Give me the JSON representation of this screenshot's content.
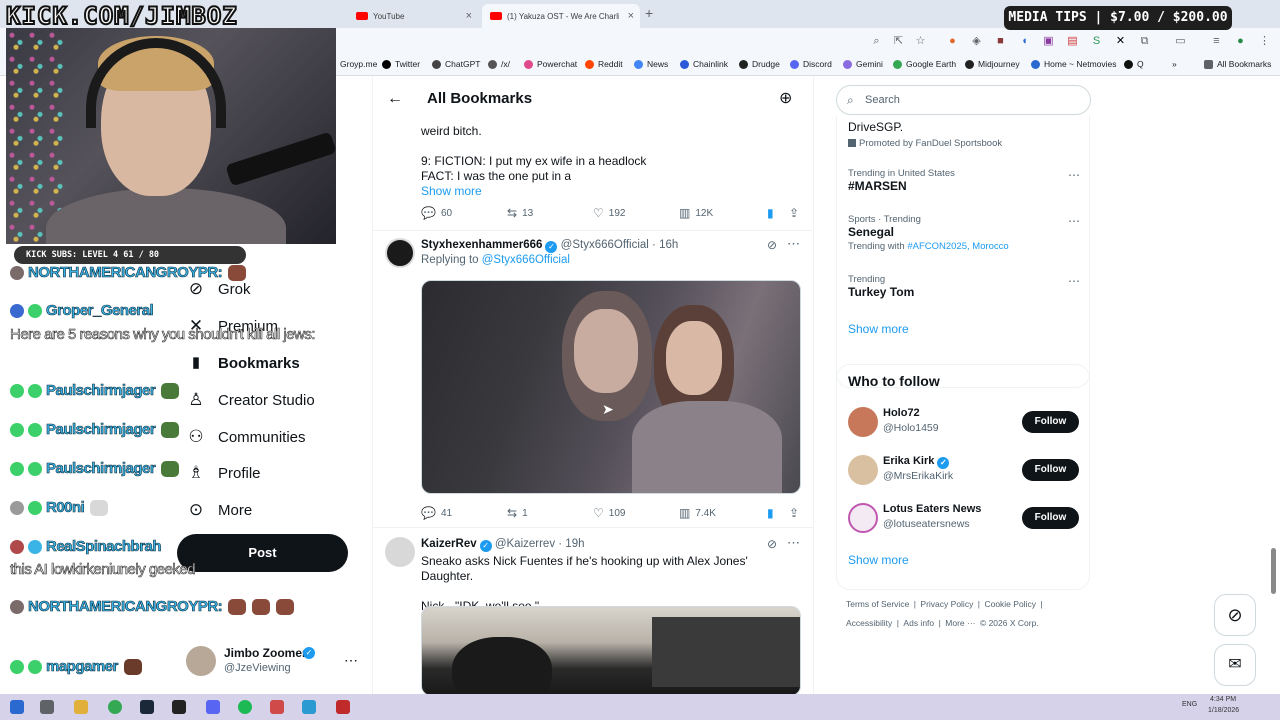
{
  "overlay": {
    "channel_url": "KICK.COM/JIMBOZ",
    "subs_bar": "KICK SUBS: LEVEL 4 61 / 80",
    "media_tips": "MEDIA TIPS | $7.00 / $200.00",
    "chat": [
      {
        "name": "NORTHAMERICANGROYPR:",
        "msg": "",
        "badge": "#7a6a6a"
      },
      {
        "name": "Groper_General",
        "msg": "",
        "badge": "#3a6ad0"
      },
      {
        "name": "",
        "msg": "Here are 5 reasons why you shouldn't kill all jews:",
        "badge": ""
      },
      {
        "name": "Paulschirmjager",
        "msg": "",
        "badge": "#3bd06a"
      },
      {
        "name": "Paulschirmjager",
        "msg": "",
        "badge": "#3bd06a"
      },
      {
        "name": "Paulschirmjager",
        "msg": "",
        "badge": "#3bd06a"
      },
      {
        "name": "R00ni",
        "msg": "",
        "badge": "#9a9a9a"
      },
      {
        "name": "RealSpinachbrah",
        "msg": "",
        "badge": "#b04a4a"
      },
      {
        "name": "",
        "msg": "this AI lowkirkeniunely geeked",
        "badge": ""
      },
      {
        "name": "NORTHAMERICANGROYPR:",
        "msg": "",
        "badge": "#7a6a6a"
      },
      {
        "name": "mapgamer",
        "msg": "",
        "badge": "#3bd06a"
      }
    ]
  },
  "browser": {
    "tabs": [
      {
        "label": "YouTube",
        "color": "#ff0000"
      },
      {
        "label": "(1) Yakuza OST - We Are Charlie",
        "color": "#ff0000"
      }
    ],
    "bookmarks": [
      {
        "label": "Groyp.me",
        "color": "#7a7a7a"
      },
      {
        "label": "Twitter",
        "color": "#000000"
      },
      {
        "label": "ChatGPT",
        "color": "#444444"
      },
      {
        "label": "/x/",
        "color": "#555555"
      },
      {
        "label": "Powerchat",
        "color": "#e04a8a"
      },
      {
        "label": "Reddit",
        "color": "#ff4500"
      },
      {
        "label": "News",
        "color": "#4285f4"
      },
      {
        "label": "Chainlink",
        "color": "#2a5ada"
      },
      {
        "label": "Drudge",
        "color": "#222222"
      },
      {
        "label": "Discord",
        "color": "#5865f2"
      },
      {
        "label": "Gemini",
        "color": "#8a6ae0"
      },
      {
        "label": "Google Earth",
        "color": "#34a853"
      },
      {
        "label": "Midjourney",
        "color": "#222222"
      },
      {
        "label": "Home ~ Netmovies",
        "color": "#2a6ad0"
      },
      {
        "label": "Q",
        "color": "#111111"
      },
      {
        "label": "All Bookmarks",
        "color": "#5f6368"
      }
    ]
  },
  "sidebar": {
    "items": [
      {
        "label": "Grok",
        "icon": "grok-icon",
        "glyph": "⊘",
        "bold": false
      },
      {
        "label": "Premium",
        "icon": "x-logo-icon",
        "glyph": "𝕏",
        "bold": false
      },
      {
        "label": "Bookmarks",
        "icon": "bookmark-icon",
        "glyph": "🔖",
        "bold": true
      },
      {
        "label": "Creator Studio",
        "icon": "creator-studio-icon",
        "glyph": "♙",
        "bold": false
      },
      {
        "label": "Communities",
        "icon": "communities-icon",
        "glyph": "👥",
        "bold": false
      },
      {
        "label": "Profile",
        "icon": "profile-icon",
        "glyph": "👤",
        "bold": false
      },
      {
        "label": "More",
        "icon": "more-icon",
        "glyph": "⋯",
        "bold": false
      }
    ],
    "post_label": "Post",
    "account": {
      "name": "Jimbo Zoomer",
      "handle": "@JzeViewing"
    }
  },
  "main": {
    "title": "All Bookmarks",
    "tweets": [
      {
        "text_lines": [
          "weird bitch.",
          "",
          "9: FICTION: I put my ex wife in a headlock",
          "FACT: I was the one put in a"
        ],
        "show_more": "Show more",
        "replies": "60",
        "reposts": "13",
        "likes": "192",
        "views": "12K"
      },
      {
        "name": "Styxhexenhammer666",
        "handle": "@Styx666Official",
        "time": "· 16h",
        "replying_prefix": "Replying to",
        "replying_to": "@Styx666Official",
        "replies": "41",
        "reposts": "1",
        "likes": "109",
        "views": "7.4K"
      },
      {
        "name": "KaizerRev",
        "handle": "@Kaizerrev",
        "time": "· 19h",
        "text_lines": [
          "Sneako asks Nick Fuentes if he's hooking up with Alex Jones' Daughter.",
          "",
          "Nick - \"IDK, we'll see.\""
        ]
      }
    ]
  },
  "right": {
    "search_placeholder": "Search",
    "promo_name": "DriveSGP.",
    "promo_label": "Promoted by FanDuel Sportsbook",
    "trends": [
      {
        "meta": "Trending in United States",
        "name": "#MARSEN",
        "extra_prefix": "",
        "extra_links": ""
      },
      {
        "meta": "Sports · Trending",
        "name": "Senegal",
        "extra_prefix": "Trending with",
        "extra_links": "#AFCON2025, Morocco"
      },
      {
        "meta": "Trending",
        "name": "Turkey Tom",
        "extra_prefix": "",
        "extra_links": ""
      }
    ],
    "show_more": "Show more",
    "who_to_follow_title": "Who to follow",
    "follow_suggestions": [
      {
        "name": "Holo72",
        "handle": "@Holo1459",
        "verified": false,
        "follow": "Follow"
      },
      {
        "name": "Erika Kirk",
        "handle": "@MrsErikaKirk",
        "verified": true,
        "follow": "Follow"
      },
      {
        "name": "Lotus Eaters News",
        "handle": "@lotuseatersnews",
        "verified": false,
        "follow": "Follow"
      }
    ],
    "footer": [
      "Terms of Service",
      "Privacy Policy",
      "Cookie Policy",
      "Accessibility",
      "Ads info",
      "More ···",
      "© 2026 X Corp."
    ]
  },
  "taskbar": {
    "time": "4:34 PM",
    "date": "1/18/2026",
    "lang": "ENG"
  }
}
